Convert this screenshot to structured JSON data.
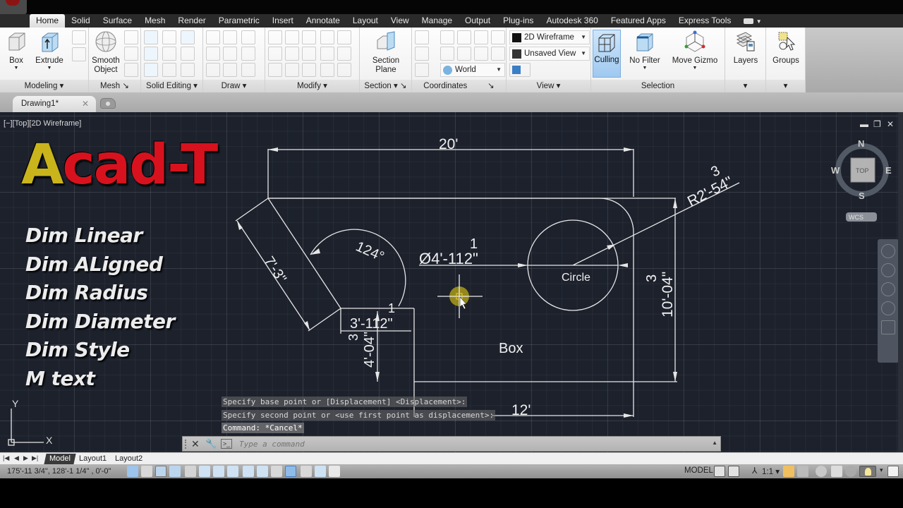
{
  "ribbon": {
    "tabs": [
      "Home",
      "Solid",
      "Surface",
      "Mesh",
      "Render",
      "Parametric",
      "Insert",
      "Annotate",
      "Layout",
      "View",
      "Manage",
      "Output",
      "Plug-ins",
      "Autodesk 360",
      "Featured Apps",
      "Express Tools"
    ],
    "active_tab": "Home",
    "panels": {
      "modeling": {
        "title": "Modeling",
        "box": "Box",
        "extrude": "Extrude"
      },
      "mesh": {
        "title": "Mesh",
        "smooth_object_1": "Smooth",
        "smooth_object_2": "Object"
      },
      "solid_editing": {
        "title": "Solid Editing"
      },
      "draw": {
        "title": "Draw"
      },
      "modify": {
        "title": "Modify"
      },
      "section": {
        "title": "Section",
        "section_plane_1": "Section",
        "section_plane_2": "Plane"
      },
      "coordinates": {
        "title": "Coordinates",
        "world": "World"
      },
      "view": {
        "title": "View",
        "visual_style": "2D Wireframe",
        "named_view": "Unsaved View"
      },
      "selection": {
        "title": "Selection",
        "culling": "Culling",
        "no_filter": "No Filter",
        "move_gizmo": "Move Gizmo"
      },
      "layers": {
        "label": "Layers"
      },
      "groups": {
        "label": "Groups"
      }
    }
  },
  "file_tabs": {
    "active": "Drawing1*"
  },
  "viewport": {
    "label": "[−][Top][2D Wireframe]",
    "brand_a": "A",
    "brand_rest": "cad-T",
    "topics": [
      "Dim Linear",
      "Dim ALigned",
      "Dim Radius",
      "Dim Diameter",
      "Dim Style",
      "M text"
    ],
    "drawing": {
      "dim_top": "20'",
      "dim_bottom": "12'",
      "dim_aligned": "7'-3\"",
      "dim_angle": "124°",
      "dim_diameter": "Ø4'-112\"",
      "dim_diameter_frac": "1",
      "dim_radius": "R2'-54\"",
      "dim_radius_frac": "3",
      "dim_vertical_right": "10'-04\"",
      "dim_vertical_right_frac": "3",
      "dim_small_h": "3'-112\"",
      "dim_small_h_frac": "1",
      "dim_small_v": "4'-04\"",
      "dim_small_v_frac": "3",
      "label_circle": "Circle",
      "label_box": "Box"
    },
    "viewcube": {
      "face": "TOP",
      "n": "N",
      "s": "S",
      "e": "E",
      "w": "W",
      "ucs": "WCS"
    },
    "ucs_icon": {
      "x": "X",
      "y": "Y"
    }
  },
  "command": {
    "history": [
      "Specify base point or [Displacement] <Displacement>:",
      "Specify second point or <use first point as displacement>:",
      "Command: *Cancel*"
    ],
    "placeholder": "Type a command"
  },
  "layout_tabs": [
    "Model",
    "Layout1",
    "Layout2"
  ],
  "status": {
    "coordinates": "175'-11 3/4\", 128'-1 1/4\" , 0'-0\"",
    "space": "MODEL",
    "scale": "1:1"
  }
}
